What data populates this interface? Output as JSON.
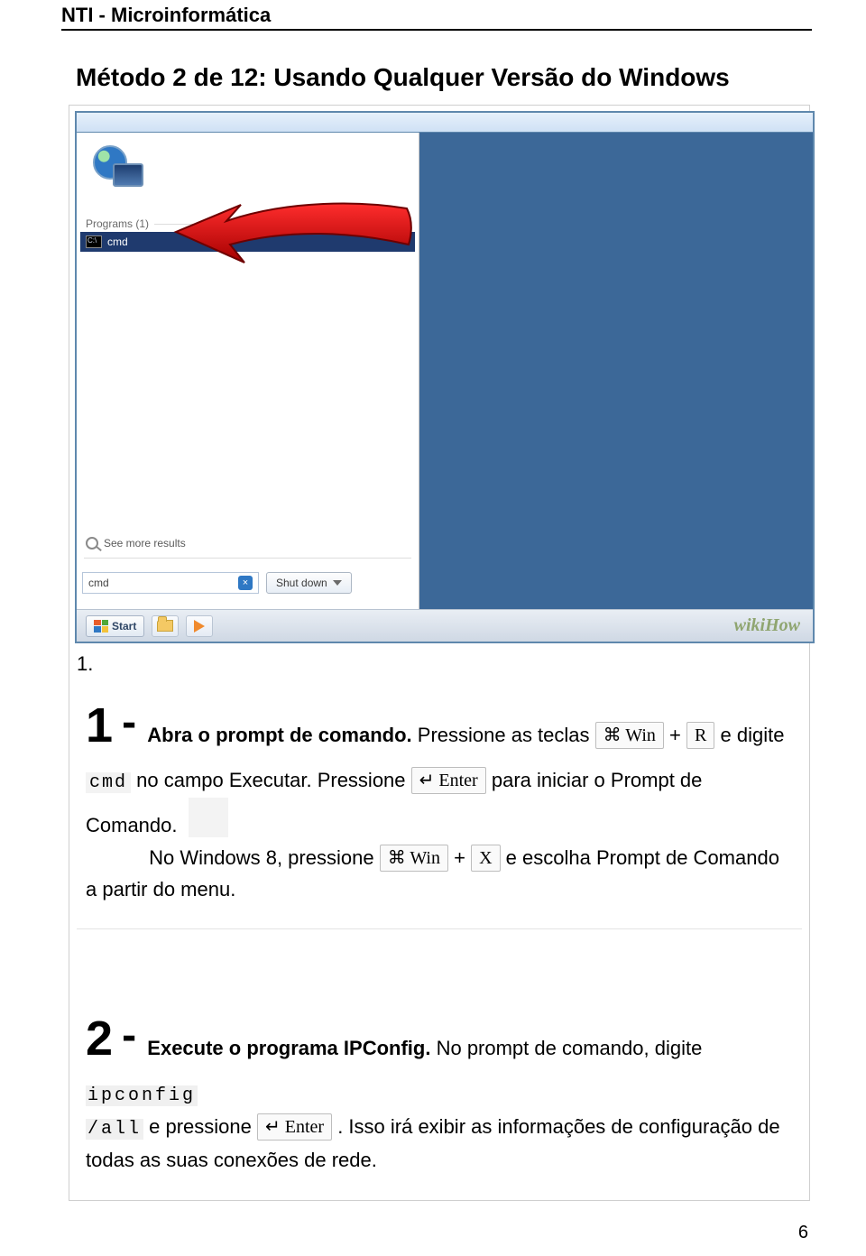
{
  "header": {
    "site": "NTI - Microinformática"
  },
  "method_title": "Método 2 de 12: Usando Qualquer Versão do Windows",
  "list_marker": "1.",
  "screenshot": {
    "programs_label": "Programs (1)",
    "cmd_item": "cmd",
    "see_more": "See more results",
    "search_value": "cmd",
    "shutdown_label": "Shut down",
    "start_label": "Start",
    "watermark": "wikiHow"
  },
  "step1": {
    "index": "1",
    "dash": "-",
    "lead": "Abra o prompt de comando.",
    "t1": " Pressione as teclas ",
    "key_win": "⌘ Win",
    "plus": "+",
    "key_r": "R",
    "t2": " e digite ",
    "cmd_code": "cmd",
    "t3": " no campo Executar. Pressione ",
    "key_enter": "↵ Enter",
    "t4": " para iniciar o Prompt de Comando.",
    "line2_pre": "No Windows 8, pressione ",
    "key_win2": "⌘ Win",
    "plus2": "+",
    "key_x": "X",
    "line2_post": " e escolha Prompt de Comando a partir do menu."
  },
  "step2": {
    "index": "2",
    "dash": "-",
    "lead": "Execute o programa IPConfig.",
    "t1": " No prompt de comando, digite ",
    "ipconfig": "ipconfig",
    "all": "/all",
    "t2": " e pressione ",
    "key_enter": "↵ Enter",
    "t3": ". Isso irá exibir as informações de configuração de todas as suas conexões de rede."
  },
  "page_number": "6"
}
